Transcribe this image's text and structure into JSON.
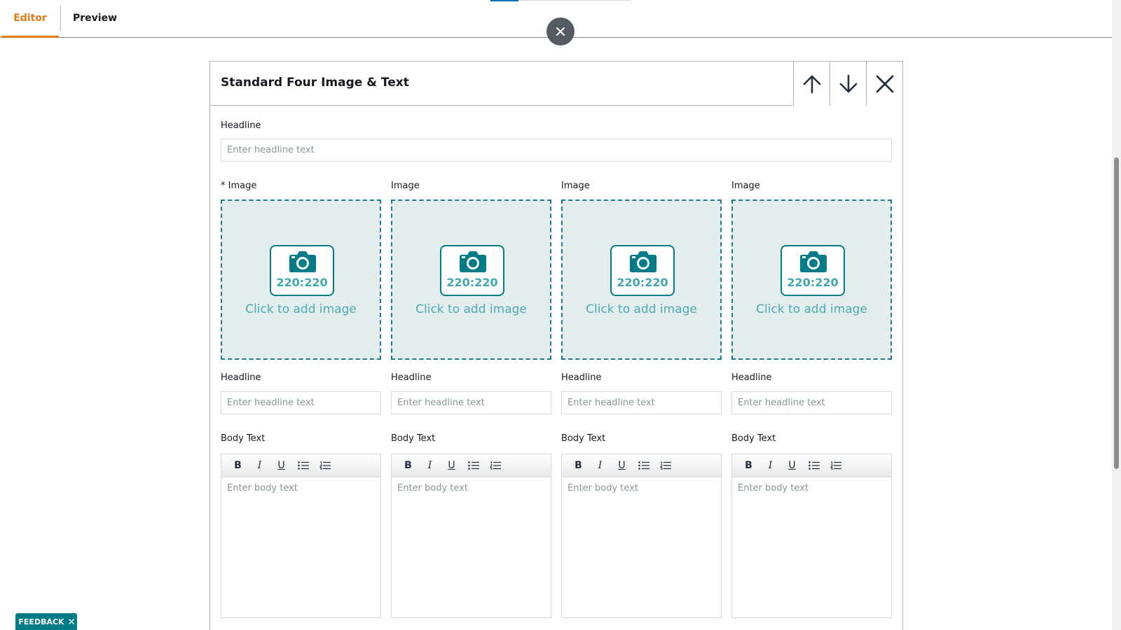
{
  "tabs": [
    {
      "label": "Editor",
      "active": true
    },
    {
      "label": "Preview",
      "active": false
    }
  ],
  "module": {
    "title": "Standard Four Image & Text",
    "headline_label": "Headline",
    "headline_placeholder": "Enter headline text",
    "columns": [
      {
        "image_label": "* Image",
        "ratio": "220:220",
        "click_text": "Click to add image",
        "headline_label": "Headline",
        "headline_placeholder": "Enter headline text",
        "body_label": "Body Text",
        "body_placeholder": "Enter body text"
      },
      {
        "image_label": "Image",
        "ratio": "220:220",
        "click_text": "Click to add image",
        "headline_label": "Headline",
        "headline_placeholder": "Enter headline text",
        "body_label": "Body Text",
        "body_placeholder": "Enter body text"
      },
      {
        "image_label": "Image",
        "ratio": "220:220",
        "click_text": "Click to add image",
        "headline_label": "Headline",
        "headline_placeholder": "Enter headline text",
        "body_label": "Body Text",
        "body_placeholder": "Enter body text"
      },
      {
        "image_label": "Image",
        "ratio": "220:220",
        "click_text": "Click to add image",
        "headline_label": "Headline",
        "headline_placeholder": "Enter headline text",
        "body_label": "Body Text",
        "body_placeholder": "Enter body text"
      }
    ],
    "toolbar": {
      "bold": "B",
      "italic": "I",
      "underline": "U"
    }
  },
  "feedback": {
    "label": "FEEDBACK"
  },
  "colors": {
    "active_tab": "#e07b12",
    "accent_teal": "#007c89",
    "drop_bg": "#e4eded",
    "close_bg": "#545b64"
  },
  "icons": [
    "close-icon",
    "arrow-up-icon",
    "arrow-down-icon",
    "remove-icon",
    "camera-icon",
    "bullet-list-icon",
    "numbered-list-icon"
  ]
}
